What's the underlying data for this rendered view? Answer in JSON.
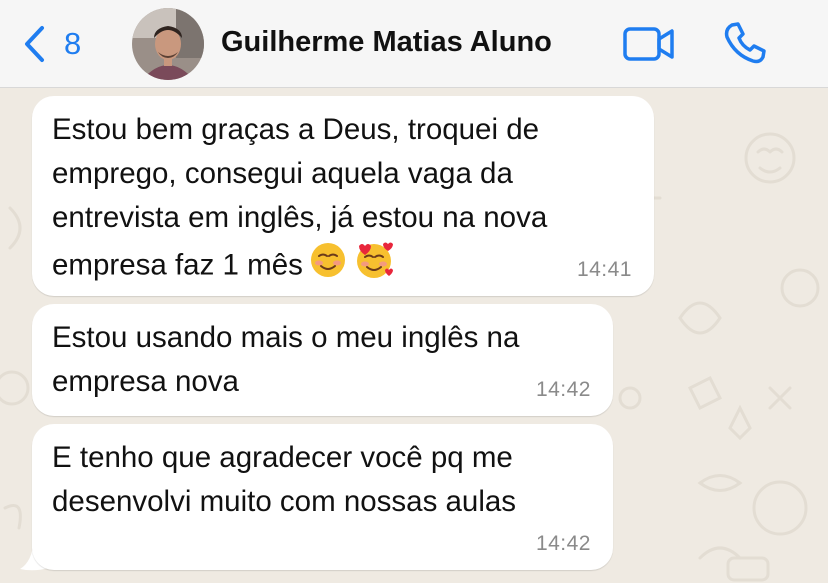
{
  "header": {
    "back_count": "8",
    "contact_name": "Guilherme Matias Aluno",
    "icons": {
      "back": "chevron-left-icon",
      "video": "video-camera-icon",
      "call": "phone-icon"
    },
    "accent_color": "#1f7df0"
  },
  "messages": [
    {
      "lines": [
        "Estou bem graças a Deus, troquei de",
        "emprego, consegui aquela vaga da",
        "entrevista em inglês, já estou na nova",
        "empresa faz 1 mês"
      ],
      "emojis": [
        "☺️",
        "🥰"
      ],
      "time": "14:41"
    },
    {
      "lines": [
        "Estou usando mais o meu inglês na",
        "empresa nova"
      ],
      "time": "14:42"
    },
    {
      "lines": [
        "E tenho que agradecer você pq me",
        "desenvolvi muito com nossas aulas"
      ],
      "time": "14:42"
    }
  ],
  "colors": {
    "header_bg": "#f6f6f6",
    "chat_bg": "#efeae2",
    "bubble_bg": "#ffffff",
    "time_text": "#8a8a8a"
  }
}
